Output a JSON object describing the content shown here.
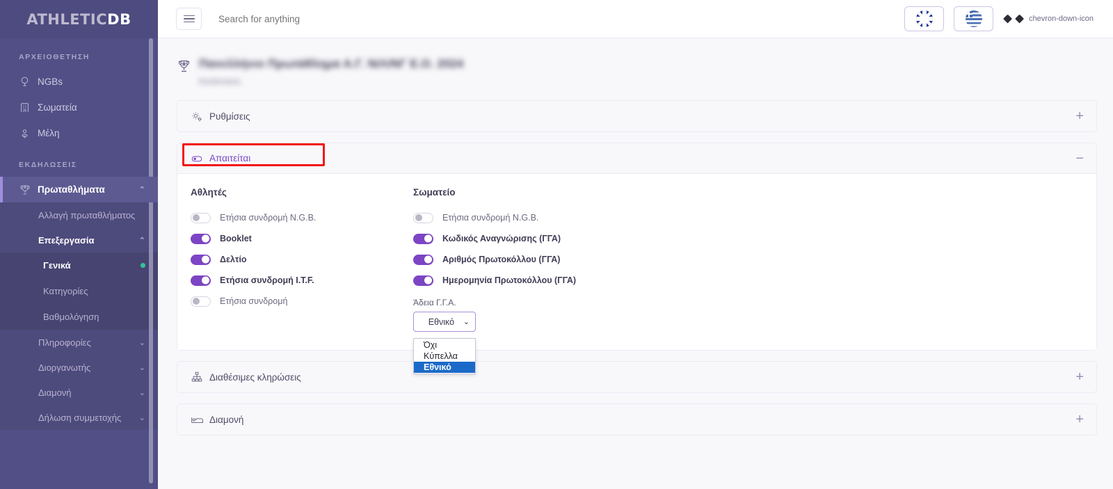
{
  "brand": {
    "part1": "ATHLETIC",
    "part2": "DB"
  },
  "topbar": {
    "menu_icon": "hamburger-icon",
    "search_placeholder": "Search for anything",
    "lang_en": "flag-uk-icon",
    "lang_el": "flag-greece-icon",
    "account_chevron": "chevron-down-icon"
  },
  "sidebar": {
    "sections": [
      {
        "label": "ΑΡΧΕΙΟΘΕΤΗΣΗ",
        "items": [
          {
            "label": "NGBs",
            "icon": "globe-icon"
          },
          {
            "label": "Σωματεία",
            "icon": "building-icon"
          },
          {
            "label": "Μέλη",
            "icon": "person-pin-icon"
          }
        ]
      },
      {
        "label": "ΕΚΔΗΛΩΣΕΙΣ",
        "items": [
          {
            "label": "Πρωταθλήματα",
            "icon": "trophy-gear-icon",
            "active": true,
            "chevron": "⌃"
          }
        ]
      }
    ],
    "sub_items": [
      {
        "label": "Αλλαγή πρωταθλήματος"
      },
      {
        "label": "Επεξεργασία",
        "open": true,
        "chevron": "⌃"
      }
    ],
    "sub2_items": [
      {
        "label": "Γενικά",
        "current": true,
        "dot": true
      },
      {
        "label": "Κατηγορίες"
      },
      {
        "label": "Βαθμολόγηση"
      }
    ],
    "tail_items": [
      {
        "label": "Πληροφορίες",
        "chevron": "⌄"
      },
      {
        "label": "Διοργανωτής",
        "chevron": "⌄"
      },
      {
        "label": "Διαμονή",
        "chevron": "⌄"
      },
      {
        "label": "Δήλωση συμμετοχής",
        "chevron": "⌄"
      }
    ]
  },
  "page": {
    "icon": "trophy-icon",
    "title": "Πανελλήνιο Πρωτάθλημα Α.Γ. Ν/Λ/ΝΓ Ε.Ο. 2024",
    "subtitle": "Κατάσταση"
  },
  "panels": [
    {
      "id": "settings",
      "icon": "gear-icon",
      "title": "Ρυθμίσεις",
      "toggler": "+",
      "expanded": false
    },
    {
      "id": "required",
      "icon": "toggle-icon",
      "title": "Απαιτείται",
      "toggler": "−",
      "expanded": true,
      "highlighted": true
    },
    {
      "id": "draws",
      "icon": "org-chart-icon",
      "title": "Διαθέσιμες κληρώσεις",
      "toggler": "+",
      "expanded": false
    },
    {
      "id": "accommodation",
      "icon": "bed-icon",
      "title": "Διαμονή",
      "toggler": "+",
      "expanded": false
    }
  ],
  "required_panel": {
    "columns": [
      {
        "title": "Αθλητές",
        "toggles": [
          {
            "label": "Ετήσια συνδρομή N.G.B.",
            "on": false
          },
          {
            "label": "Booklet",
            "on": true
          },
          {
            "label": "Δελτίο",
            "on": true
          },
          {
            "label": "Ετήσια συνδρομή I.T.F.",
            "on": true
          },
          {
            "label": "Ετήσια συνδρομή",
            "on": false
          }
        ]
      },
      {
        "title": "Σωματείο",
        "toggles": [
          {
            "label": "Ετήσια συνδρομή N.G.B.",
            "on": false
          },
          {
            "label": "Κωδικός Αναγνώρισης (ΓΓΑ)",
            "on": true
          },
          {
            "label": "Αριθμός Πρωτοκόλλου (ΓΓΑ)",
            "on": true
          },
          {
            "label": "Ημερομηνία Πρωτοκόλλου (ΓΓΑ)",
            "on": true
          }
        ],
        "select": {
          "label": "Άδεια Γ.Γ.Α.",
          "value": "Εθνικό",
          "chevron": "⌄",
          "open": true,
          "options": [
            {
              "label": "Όχι",
              "selected": false
            },
            {
              "label": "Κύπελλα",
              "selected": false
            },
            {
              "label": "Εθνικό",
              "selected": true
            }
          ]
        }
      }
    ]
  },
  "colors": {
    "sidebar_bg": "#524f86",
    "accent_purple": "#7c45c4",
    "toggle_on": "#7c45c4",
    "highlight_red": "#f41313",
    "option_selected": "#1b6ac9",
    "active_dot_green": "#32c49a",
    "main_bg": "#f8f8fb"
  }
}
